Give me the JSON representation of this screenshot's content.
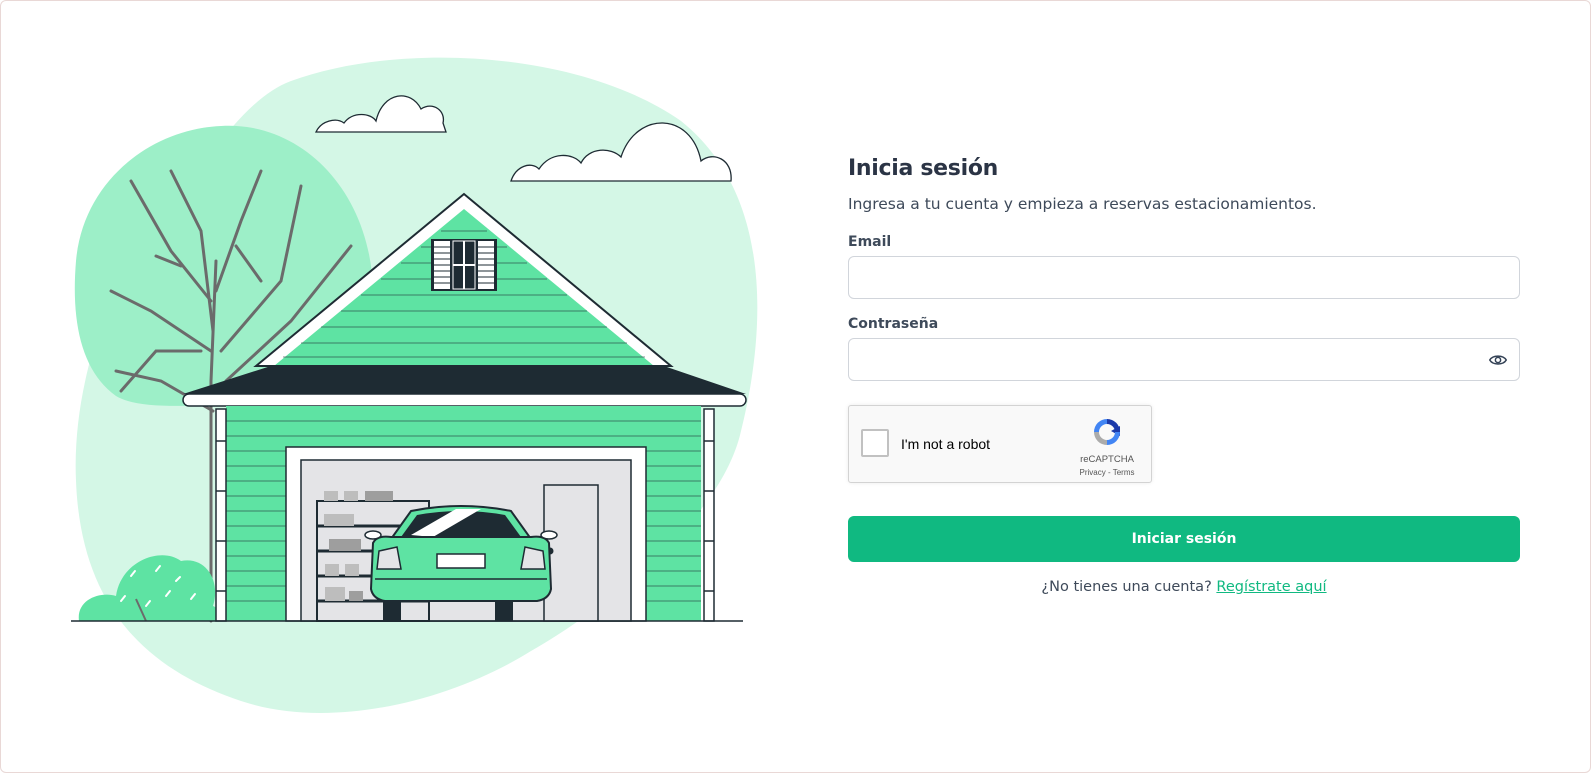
{
  "login": {
    "title": "Inicia sesión",
    "subtitle": "Ingresa a tu cuenta y empieza a reservas estacionamientos.",
    "email_label": "Email",
    "email_value": "",
    "password_label": "Contraseña",
    "password_value": "",
    "recaptcha_label": "I'm not a robot",
    "recaptcha_brand": "reCAPTCHA",
    "recaptcha_privacy": "Privacy",
    "recaptcha_terms": "Terms",
    "submit_label": "Iniciar sesión",
    "signup_prompt": "¿No tienes una cuenta?",
    "signup_link": "Regístrate aquí"
  },
  "colors": {
    "accent": "#10b981",
    "illustration_green": "#5ee3a3",
    "illustration_light": "#d4f7e6",
    "illustration_dark": "#1e2b33"
  },
  "icons": {
    "password_toggle": "eye-icon",
    "recaptcha_logo": "recaptcha-logo-icon"
  }
}
